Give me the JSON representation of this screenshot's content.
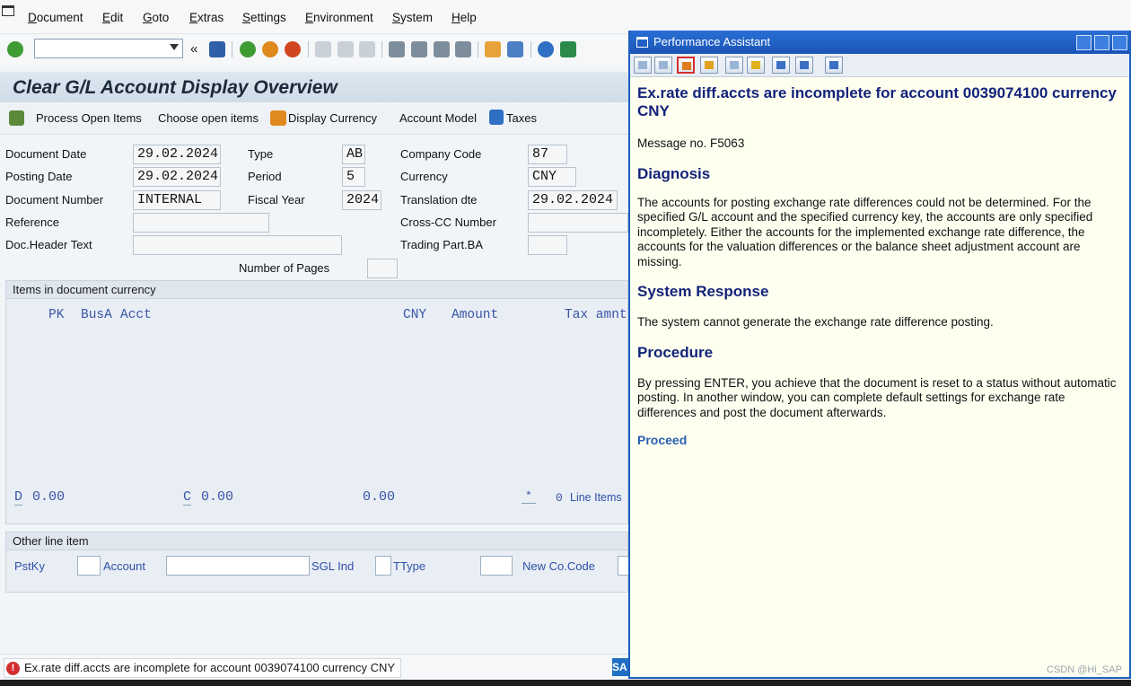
{
  "menu": [
    "Document",
    "Edit",
    "Goto",
    "Extras",
    "Settings",
    "Environment",
    "System",
    "Help"
  ],
  "toolbar": {
    "back_chevrons": "«"
  },
  "page_title": "Clear G/L Account Display Overview",
  "app_toolbar": {
    "process_open_items": "Process Open Items",
    "choose_open_items": "Choose open items",
    "display_currency": "Display Currency",
    "account_model": "Account Model",
    "taxes": "Taxes"
  },
  "header": {
    "document_date_label": "Document Date",
    "document_date": "29.02.2024",
    "posting_date_label": "Posting Date",
    "posting_date": "29.02.2024",
    "document_number_label": "Document Number",
    "document_number": "INTERNAL",
    "reference_label": "Reference",
    "reference": "",
    "doc_header_text_label": "Doc.Header Text",
    "doc_header_text": "",
    "type_label": "Type",
    "type": "AB",
    "period_label": "Period",
    "period": "5",
    "fiscal_year_label": "Fiscal Year",
    "fiscal_year": "2024",
    "company_code_label": "Company Code",
    "company_code": "87",
    "currency_label": "Currency",
    "currency": "CNY",
    "translation_dte_label": "Translation dte",
    "translation_dte": "29.02.2024",
    "cross_cc_label": "Cross-CC Number",
    "cross_cc": "",
    "trading_part_label": "Trading Part.BA",
    "trading_part": "",
    "number_of_pages_label": "Number of Pages",
    "number_of_pages": ""
  },
  "items": {
    "title": "Items in document currency",
    "columns": {
      "pk": "PK",
      "busa": "BusA",
      "acct": "Acct",
      "cny": "CNY",
      "amount": "Amount",
      "tax": "Tax amnt"
    },
    "debit_label": "D",
    "debit_total": "0.00",
    "credit_label": "C",
    "credit_total": "0.00",
    "balance": "0.00",
    "star": "*",
    "line_items_count": "0",
    "line_items_label": "Line Items"
  },
  "other_line_item": {
    "title": "Other line item",
    "pstky_label": "PstKy",
    "account_label": "Account",
    "sgl_ind_label": "SGL Ind",
    "ttype_label": "TType",
    "new_co_code_label": "New Co.Code"
  },
  "status": {
    "message": "Ex.rate diff.accts are incomplete for account 0039074100 currency CNY",
    "sap_logo": "SA"
  },
  "performance_assistant": {
    "window_title": "Performance Assistant",
    "heading": "Ex.rate diff.accts are incomplete for account 0039074100 currency CNY",
    "message_no": "Message no. F5063",
    "diagnosis_title": "Diagnosis",
    "diagnosis_text": "The accounts for posting exchange rate differences could not be determined. For the specified G/L account and the specified currency key, the accounts are only specified incompletely. Either the accounts for the implemented exchange rate difference, the accounts for the valuation differences or the balance sheet adjustment account are missing.",
    "system_response_title": "System Response",
    "system_response_text": "The system cannot generate the exchange rate difference posting.",
    "procedure_title": "Procedure",
    "procedure_text": "By pressing ENTER, you achieve that the document is reset to a status without automatic posting. In another window, you can complete default settings for exchange rate differences and post the document afterwards.",
    "proceed_link": "Proceed",
    "watermark": "CSDN @Hi_SAP"
  },
  "colors": {
    "accent": "#1b5fbf",
    "link": "#2f4fa8",
    "error": "#d32f2f",
    "pa_heading": "#13237a"
  }
}
